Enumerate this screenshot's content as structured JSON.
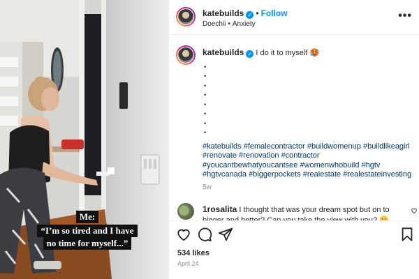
{
  "post": {
    "username": "katebuilds",
    "verified_glyph": "✓",
    "follow_label": "Follow",
    "audio_artist": "Doechii",
    "audio_track": "Anxiety",
    "more_glyph": "•••"
  },
  "caption": {
    "username": "katebuilds",
    "text": "I do it to myself 🥵",
    "bullet_count": 8,
    "hashtags": [
      "#katebuilds",
      "#femalecontractor",
      "#buildwomenup",
      "#buildlikeagirl",
      "#renovate",
      "#renovation",
      "#contractor",
      "#youcantbewhatyoucantsee",
      "#womenwhobuild",
      "#hgtv",
      "#hgtvcanada",
      "#biggerpockets",
      "#realestate",
      "#realestateinvesting"
    ],
    "age": "5w"
  },
  "comment": {
    "username": "1rosalita",
    "text": "I thought that was your dream spot but on to bigger and better? Can you take the view with you? 🥲 Wishing you"
  },
  "video_overlay": {
    "line1": "Me:",
    "line2": "“I’m so tired and I have",
    "line3": "no time for myself...”"
  },
  "footer": {
    "likes": "534 likes",
    "date": "April 24"
  },
  "icons": {
    "header_menu": "more-options-icon",
    "like": "heart-icon",
    "comment": "comment-bubble-icon",
    "share": "paper-plane-icon",
    "save": "bookmark-icon"
  },
  "colors": {
    "link_blue": "#0095f6",
    "hashtag": "#00376b",
    "muted": "#8e8e8e",
    "text": "#262626"
  }
}
